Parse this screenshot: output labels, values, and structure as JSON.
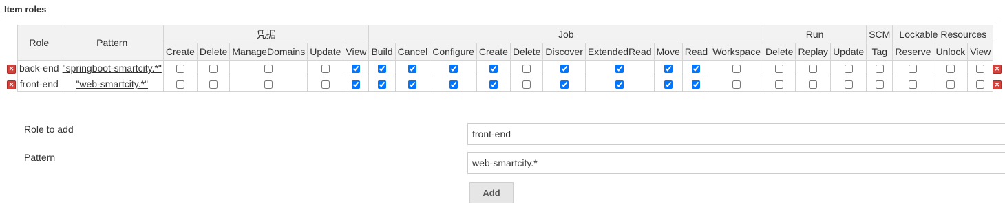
{
  "section": {
    "title": "Item roles"
  },
  "table": {
    "role_header": "Role",
    "pattern_header": "Pattern",
    "groups": [
      "凭据",
      "Job",
      "Run",
      "SCM",
      "Lockable Resources"
    ],
    "perms": {
      "cred": [
        "Create",
        "Delete",
        "ManageDomains",
        "Update",
        "View"
      ],
      "job": [
        "Build",
        "Cancel",
        "Configure",
        "Create",
        "Delete",
        "Discover",
        "ExtendedRead",
        "Move",
        "Read",
        "Workspace"
      ],
      "run": [
        "Delete",
        "Replay",
        "Update"
      ],
      "scm": [
        "Tag"
      ],
      "lock": [
        "Reserve",
        "Unlock",
        "View"
      ]
    },
    "rows": [
      {
        "role": "back-end",
        "pattern": "\"springboot-smartcity.*\"",
        "checks": [
          false,
          false,
          false,
          false,
          true,
          true,
          true,
          true,
          true,
          false,
          true,
          true,
          true,
          true,
          false,
          false,
          false,
          false,
          false,
          false,
          false,
          false
        ]
      },
      {
        "role": "front-end",
        "pattern": "\"web-smartcity.*\"",
        "checks": [
          false,
          false,
          false,
          false,
          true,
          true,
          true,
          true,
          true,
          false,
          true,
          true,
          true,
          true,
          false,
          false,
          false,
          false,
          false,
          false,
          false,
          false
        ]
      }
    ]
  },
  "form": {
    "role_label": "Role to add",
    "role_value": "front-end",
    "pattern_label": "Pattern",
    "pattern_value": "web-smartcity.*",
    "add_label": "Add"
  },
  "icons": {
    "delete": "delete-x-icon"
  },
  "colors": {
    "delete_red": "#d9403a",
    "header_bg": "#f2f2f2"
  }
}
